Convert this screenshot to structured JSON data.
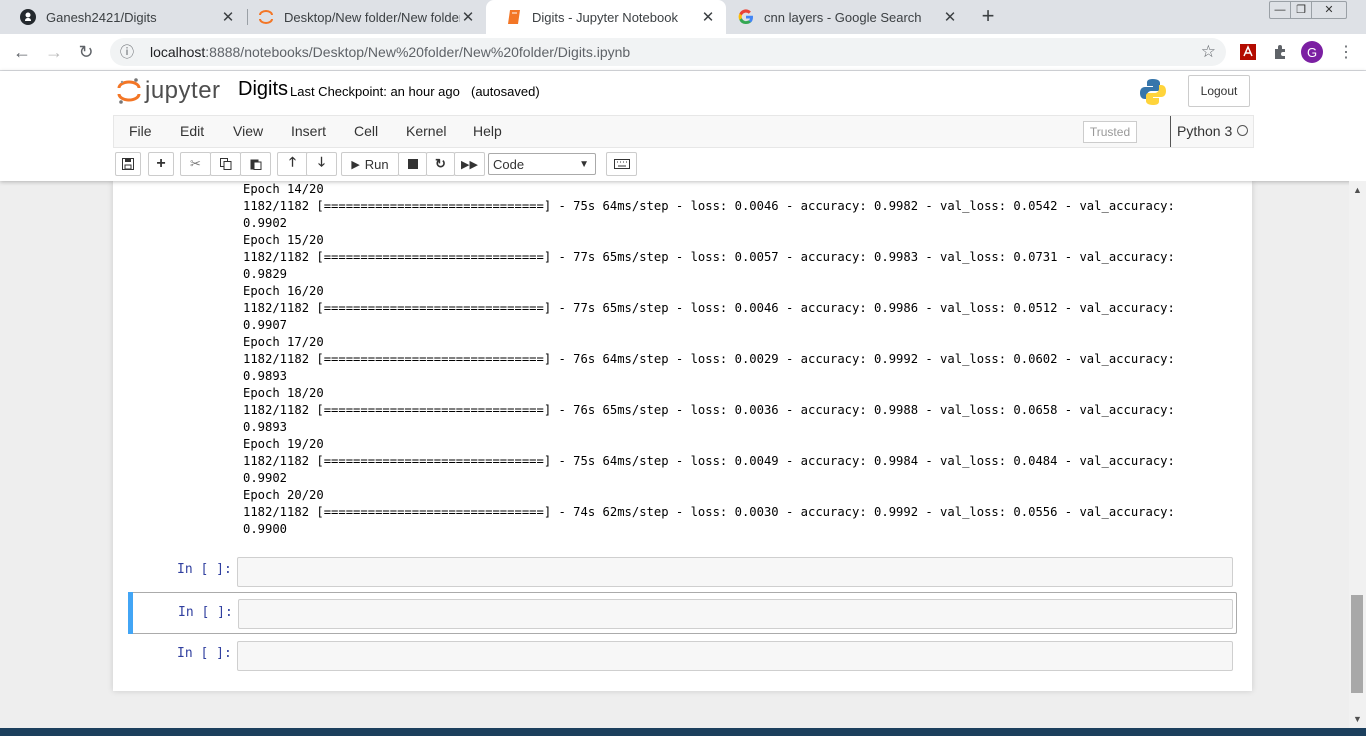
{
  "browser": {
    "tabs": [
      {
        "title": "Ganesh2421/Digits",
        "icon": "github-icon"
      },
      {
        "title": "Desktop/New folder/New folder/",
        "icon": "jupyter-icon"
      },
      {
        "title": "Digits - Jupyter Notebook",
        "icon": "notebook-icon"
      },
      {
        "title": "cnn layers - Google Search",
        "icon": "google-icon"
      }
    ],
    "url_host": "localhost",
    "url_path": ":8888/notebooks/Desktop/New%20folder/New%20folder/Digits.ipynb",
    "profile_initial": "G"
  },
  "jupyter": {
    "logo_text": "jupyter",
    "notebook_name": "Digits",
    "checkpoint": "Last Checkpoint: an hour ago",
    "autosaved": "(autosaved)",
    "logout": "Logout",
    "menu": [
      "File",
      "Edit",
      "View",
      "Insert",
      "Cell",
      "Kernel",
      "Help"
    ],
    "trusted": "Trusted",
    "kernel_name": "Python 3",
    "run_label": "Run",
    "cell_type": "Code"
  },
  "output_lines": [
    "Epoch 14/20",
    "1182/1182 [==============================] - 75s 64ms/step - loss: 0.0046 - accuracy: 0.9982 - val_loss: 0.0542 - val_accuracy:",
    "0.9902",
    "Epoch 15/20",
    "1182/1182 [==============================] - 77s 65ms/step - loss: 0.0057 - accuracy: 0.9983 - val_loss: 0.0731 - val_accuracy:",
    "0.9829",
    "Epoch 16/20",
    "1182/1182 [==============================] - 77s 65ms/step - loss: 0.0046 - accuracy: 0.9986 - val_loss: 0.0512 - val_accuracy:",
    "0.9907",
    "Epoch 17/20",
    "1182/1182 [==============================] - 76s 64ms/step - loss: 0.0029 - accuracy: 0.9992 - val_loss: 0.0602 - val_accuracy:",
    "0.9893",
    "Epoch 18/20",
    "1182/1182 [==============================] - 76s 65ms/step - loss: 0.0036 - accuracy: 0.9988 - val_loss: 0.0658 - val_accuracy:",
    "0.9893",
    "Epoch 19/20",
    "1182/1182 [==============================] - 75s 64ms/step - loss: 0.0049 - accuracy: 0.9984 - val_loss: 0.0484 - val_accuracy:",
    "0.9902",
    "Epoch 20/20",
    "1182/1182 [==============================] - 74s 62ms/step - loss: 0.0030 - accuracy: 0.9992 - val_loss: 0.0556 - val_accuracy:",
    "0.9900"
  ],
  "cells": [
    {
      "prompt": "In [ ]:"
    },
    {
      "prompt": "In [ ]:"
    },
    {
      "prompt": "In [ ]:"
    }
  ]
}
